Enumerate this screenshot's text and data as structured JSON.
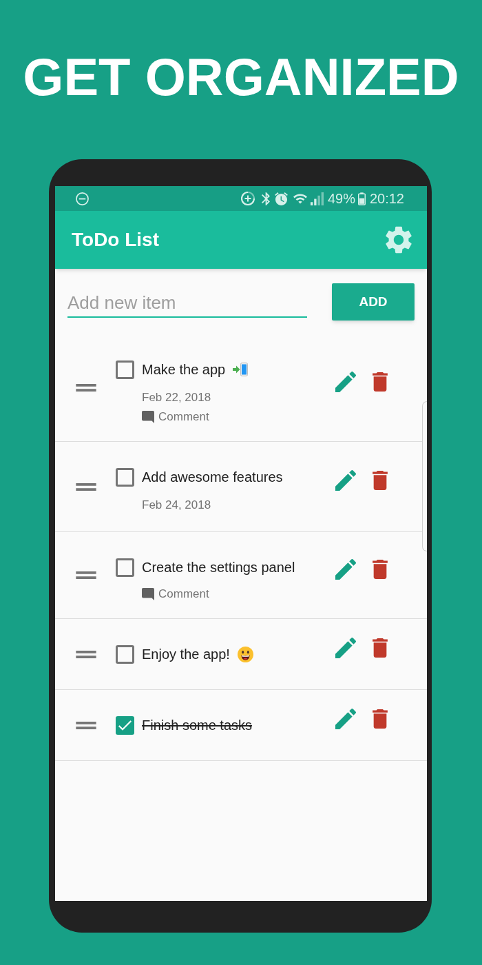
{
  "headline": "GET ORGANIZED",
  "status_bar": {
    "battery": "49%",
    "time": "20:12"
  },
  "app_bar": {
    "title": "ToDo List"
  },
  "new_item": {
    "placeholder": "Add new item",
    "button": "ADD"
  },
  "items": [
    {
      "kind": "phone",
      "title": "Make the app",
      "checked": false,
      "date": "Feb 22, 2018",
      "comment": "Comment"
    },
    {
      "kind": "plain",
      "title": "Add awesome features",
      "checked": false,
      "date": "Feb 24, 2018"
    },
    {
      "kind": "plain",
      "title": "Create the settings panel",
      "checked": false,
      "comment": "Comment"
    },
    {
      "kind": "face",
      "title": "Enjoy the app!",
      "checked": false
    },
    {
      "kind": "plain",
      "title": "Finish some tasks",
      "checked": true
    }
  ]
}
